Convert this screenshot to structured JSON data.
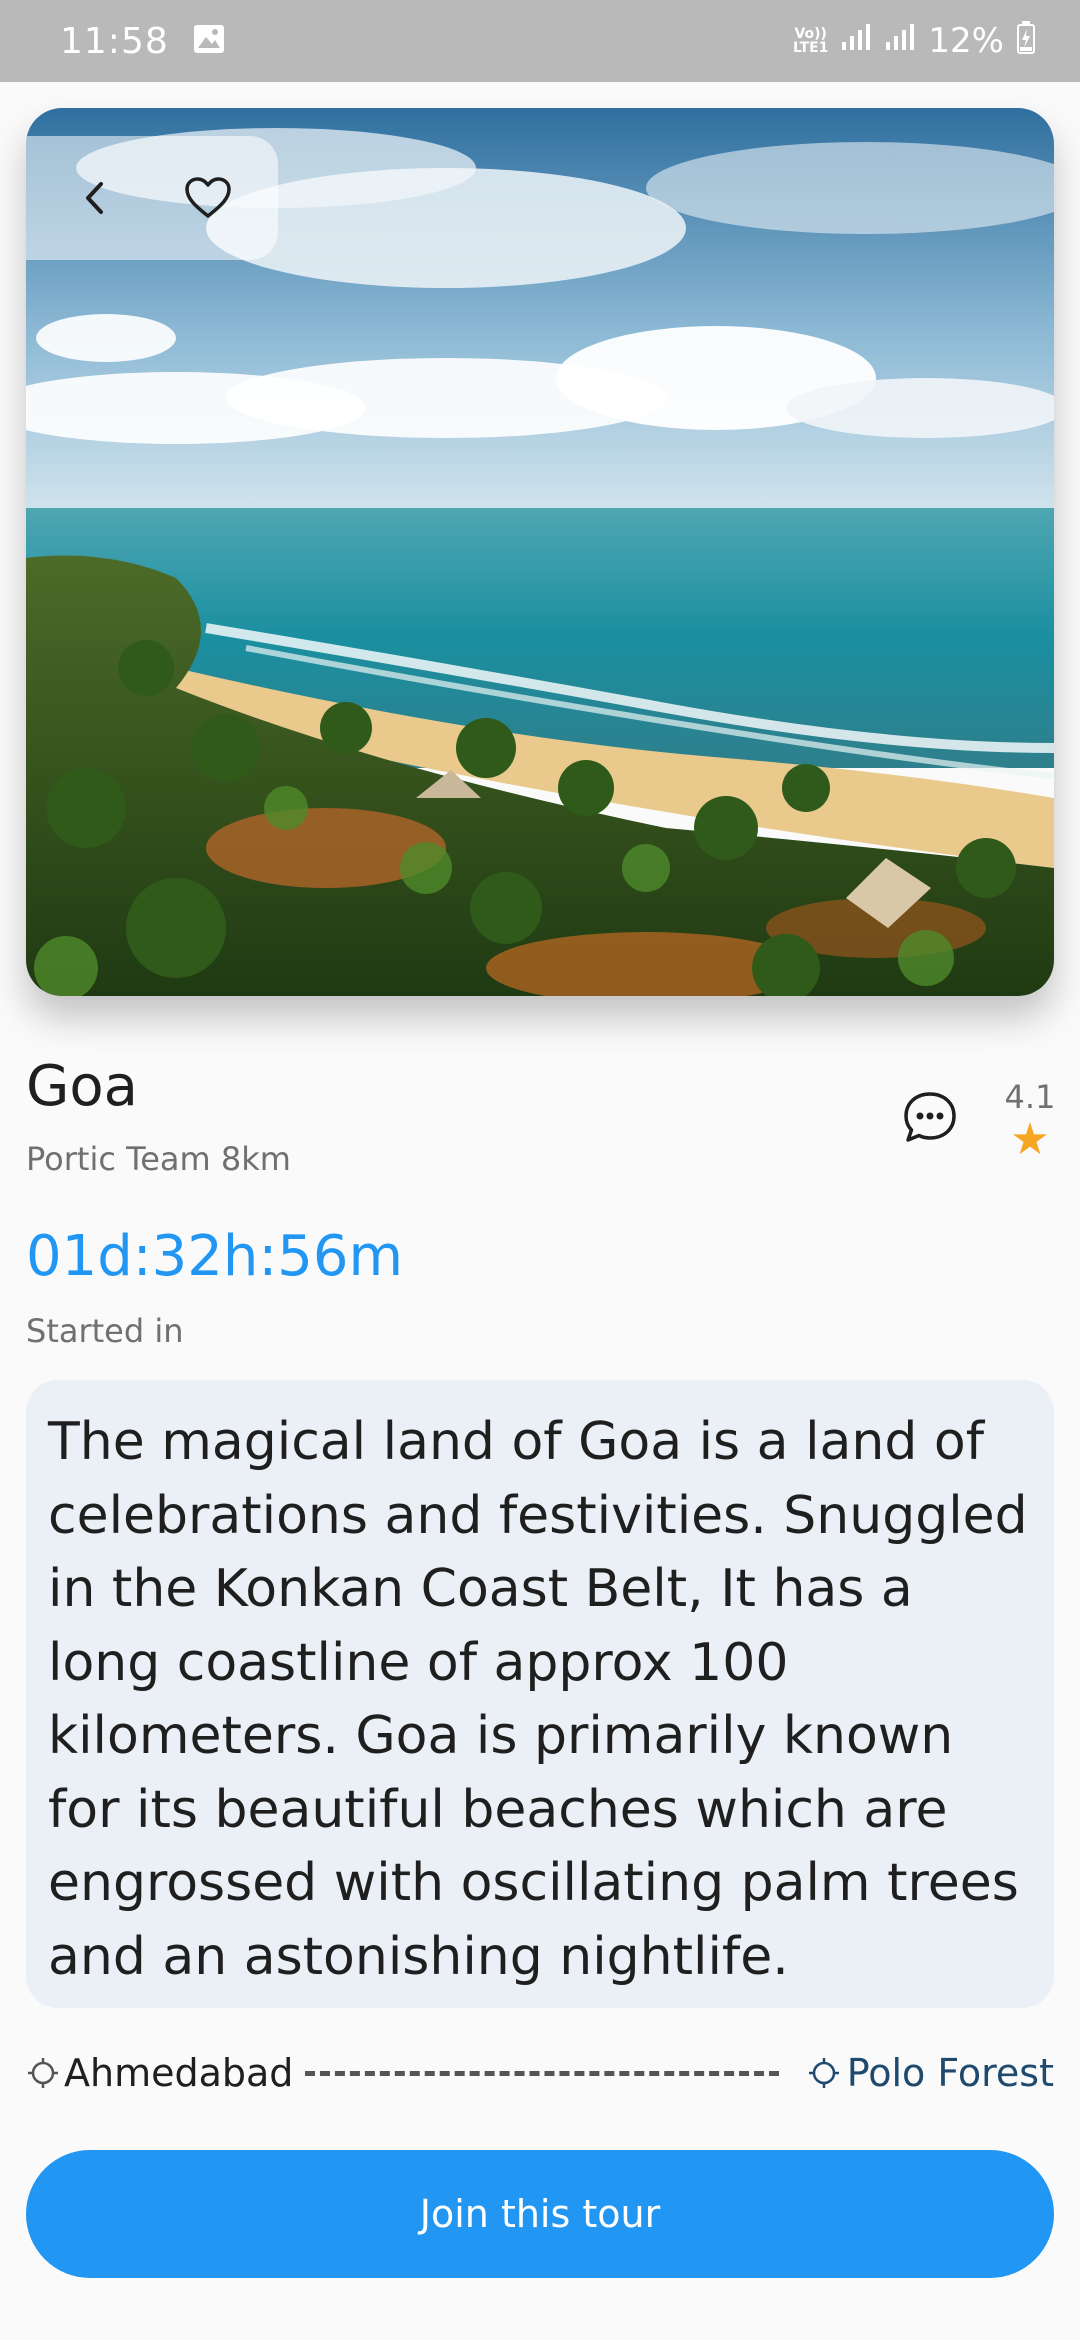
{
  "status_bar": {
    "time": "11:58",
    "gallery_icon": "image-icon",
    "network": "LTE1",
    "battery": "12%"
  },
  "hero": {
    "back_icon": "chevron-left-icon",
    "favorite_icon": "heart-outline-icon"
  },
  "place": {
    "title": "Goa",
    "subtitle": "Portic Team 8km",
    "chat_icon": "chat-bubble-icon",
    "rating": "4.1",
    "rating_icon": "star-icon"
  },
  "timer": {
    "countdown": "01d:32h:56m",
    "label": "Started in"
  },
  "description": "The magical land of Goa is a land of celebrations and festivities. Snuggled in the Konkan Coast Belt, It has a long coastline of approx 100 kilometers. Goa is primarily known for its beautiful beaches which are engrossed with oscillating palm trees and an astonishing nightlife.",
  "route": {
    "from": "Ahmedabad",
    "to": "Polo Forest"
  },
  "cta": {
    "label": "Join this tour"
  },
  "colors": {
    "accent": "#2196f3",
    "star": "#f5a623",
    "card_bg": "#eaf0f6",
    "status_bar": "#b9b9b9"
  }
}
